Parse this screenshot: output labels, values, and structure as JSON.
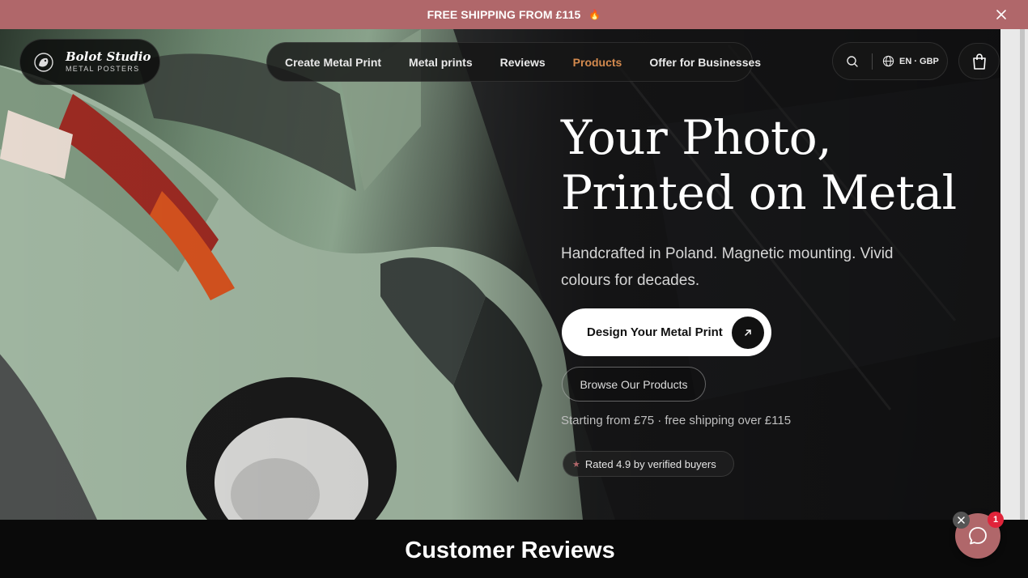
{
  "announcement": {
    "text": "FREE SHIPPING FROM £115",
    "fire_icon": "🔥"
  },
  "brand": {
    "name": "Bolot Studio",
    "tagline": "METAL POSTERS"
  },
  "nav": {
    "items": [
      {
        "label": "Create Metal Print"
      },
      {
        "label": "Metal prints"
      },
      {
        "label": "Reviews"
      },
      {
        "label": "Products",
        "active": true
      },
      {
        "label": "Offer for Businesses"
      }
    ]
  },
  "tools": {
    "language": "EN · GBP"
  },
  "hero": {
    "title_line1": "Your Photo,",
    "title_line2": "Printed on Metal",
    "subtitle": "Handcrafted in Poland. Magnetic mounting. Vivid colours for decades.",
    "primary_cta": "Design Your Metal Print",
    "secondary_cta": "Browse Our Products",
    "pricing": "Starting from £75 · free shipping over £115",
    "rating": "Rated 4.9 by verified buyers"
  },
  "reviews": {
    "heading": "Customer Reviews"
  },
  "chat": {
    "badge_count": "1"
  },
  "colors": {
    "accent": "#b0676a",
    "nav_active": "#d48a4e",
    "badge": "#e0243a"
  }
}
